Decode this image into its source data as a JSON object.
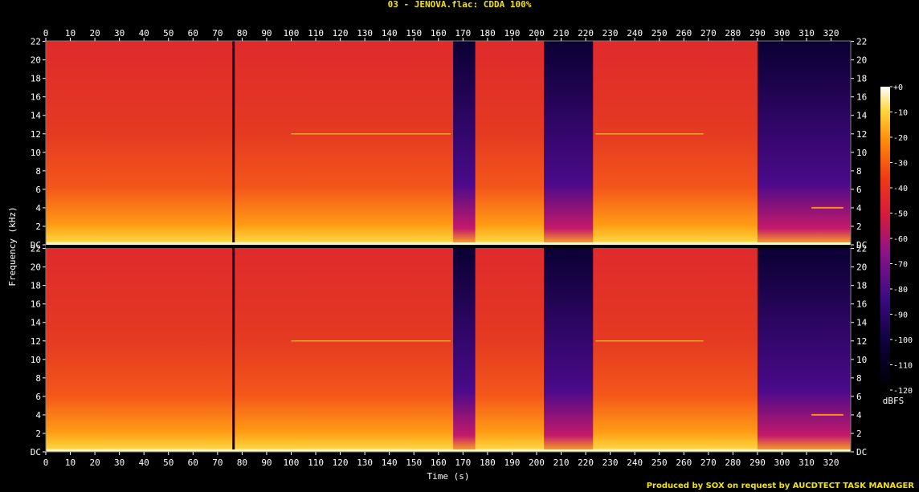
{
  "title": "03 - JENOVA.flac: CDDA 100%",
  "footer": "Produced by SOX on request by AUCDTECT TASK MANAGER",
  "colors": {
    "title": "#f2e400",
    "tick_text": "#ffffff",
    "background": "#000000"
  },
  "chart_data": {
    "type": "heatmap",
    "title": "03 - JENOVA.flac: CDDA 100%",
    "xlabel": "Time (s)",
    "ylabel": "Frequency (kHz)",
    "xlim": [
      0,
      328
    ],
    "ylim": [
      0,
      22.05
    ],
    "x_ticks": [
      "0",
      "10",
      "20",
      "30",
      "40",
      "50",
      "60",
      "70",
      "80",
      "90",
      "100",
      "110",
      "120",
      "130",
      "140",
      "150",
      "160",
      "170",
      "180",
      "190",
      "200",
      "210",
      "220",
      "230",
      "240",
      "250",
      "260",
      "270",
      "280",
      "290",
      "300",
      "310",
      "320"
    ],
    "y_ticks": [
      "DC",
      "2",
      "4",
      "6",
      "8",
      "10",
      "12",
      "14",
      "16",
      "18",
      "20",
      "22"
    ],
    "channels": [
      "Channel 1",
      "Channel 2"
    ],
    "colorbar": {
      "label": "dBFS",
      "range": [
        -120,
        0
      ],
      "ticks": [
        "+0",
        "-10",
        "-20",
        "-30",
        "-40",
        "-50",
        "-60",
        "-70",
        "-80",
        "-90",
        "-100",
        "-110",
        "-120"
      ]
    },
    "features": {
      "hf_cutoff_segments_s": [
        [
          166,
          175
        ],
        [
          203,
          223
        ],
        [
          290,
          328
        ]
      ],
      "tone_12khz_spans_s": [
        [
          100,
          165
        ],
        [
          224,
          268
        ]
      ],
      "tone_4khz_span_s": [
        312,
        325
      ],
      "gap_silence_s": [
        76,
        77
      ]
    }
  }
}
